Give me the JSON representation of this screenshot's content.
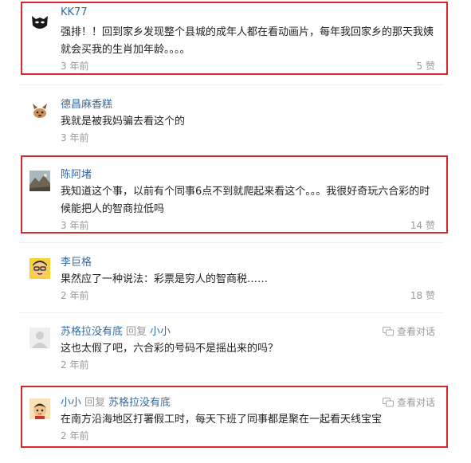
{
  "comments": [
    {
      "user": "KK77",
      "text": "强排！！回到家乡发现整个县城的成年人都在看动画片，每年我回家乡的那天我姨就会买我的生肖加年龄。。。。",
      "time": "3 年前",
      "likes": "5 赞",
      "avatar_icon": "batman-avatar-icon"
    },
    {
      "user": "德昌麻香糕",
      "text": "我就是被我妈骗去看这个的",
      "time": "3 年前",
      "likes": "",
      "avatar_icon": "cartoon-dog-avatar-icon"
    },
    {
      "user": "陈阿堵",
      "text": "我知道这个事，以前有个同事6点不到就爬起来看这个。。。我很好奇玩六合彩的时候能把人的智商拉低吗",
      "time": "3 年前",
      "likes": "14 赞",
      "avatar_icon": "landscape-photo-avatar-icon"
    },
    {
      "user": "李巨格",
      "text": "果然应了一种说法：彩票是穷人的智商税……",
      "time": "2 年前",
      "likes": "18 赞",
      "avatar_icon": "cartoon-face-avatar-icon"
    },
    {
      "user": "苏格拉没有底",
      "reply_word": "回复",
      "reply_to": "小小",
      "text": "这也太假了吧，六合彩的号码不是摇出来的吗？",
      "time": "2 年前",
      "conversation": "查看对话",
      "avatar_icon": "default-avatar-icon"
    },
    {
      "user": "小小",
      "reply_word": "回复",
      "reply_to": "苏格拉没有底",
      "text": "在南方沿海地区打署假工时，每天下班了同事都是聚在一起看天线宝宝",
      "time": "2 年前",
      "conversation": "查看对话",
      "avatar_icon": "cartoon-child-avatar-icon"
    }
  ],
  "colors": {
    "highlight": "#d9262c",
    "link": "#356aa0",
    "muted": "#999999",
    "text": "#222222"
  }
}
